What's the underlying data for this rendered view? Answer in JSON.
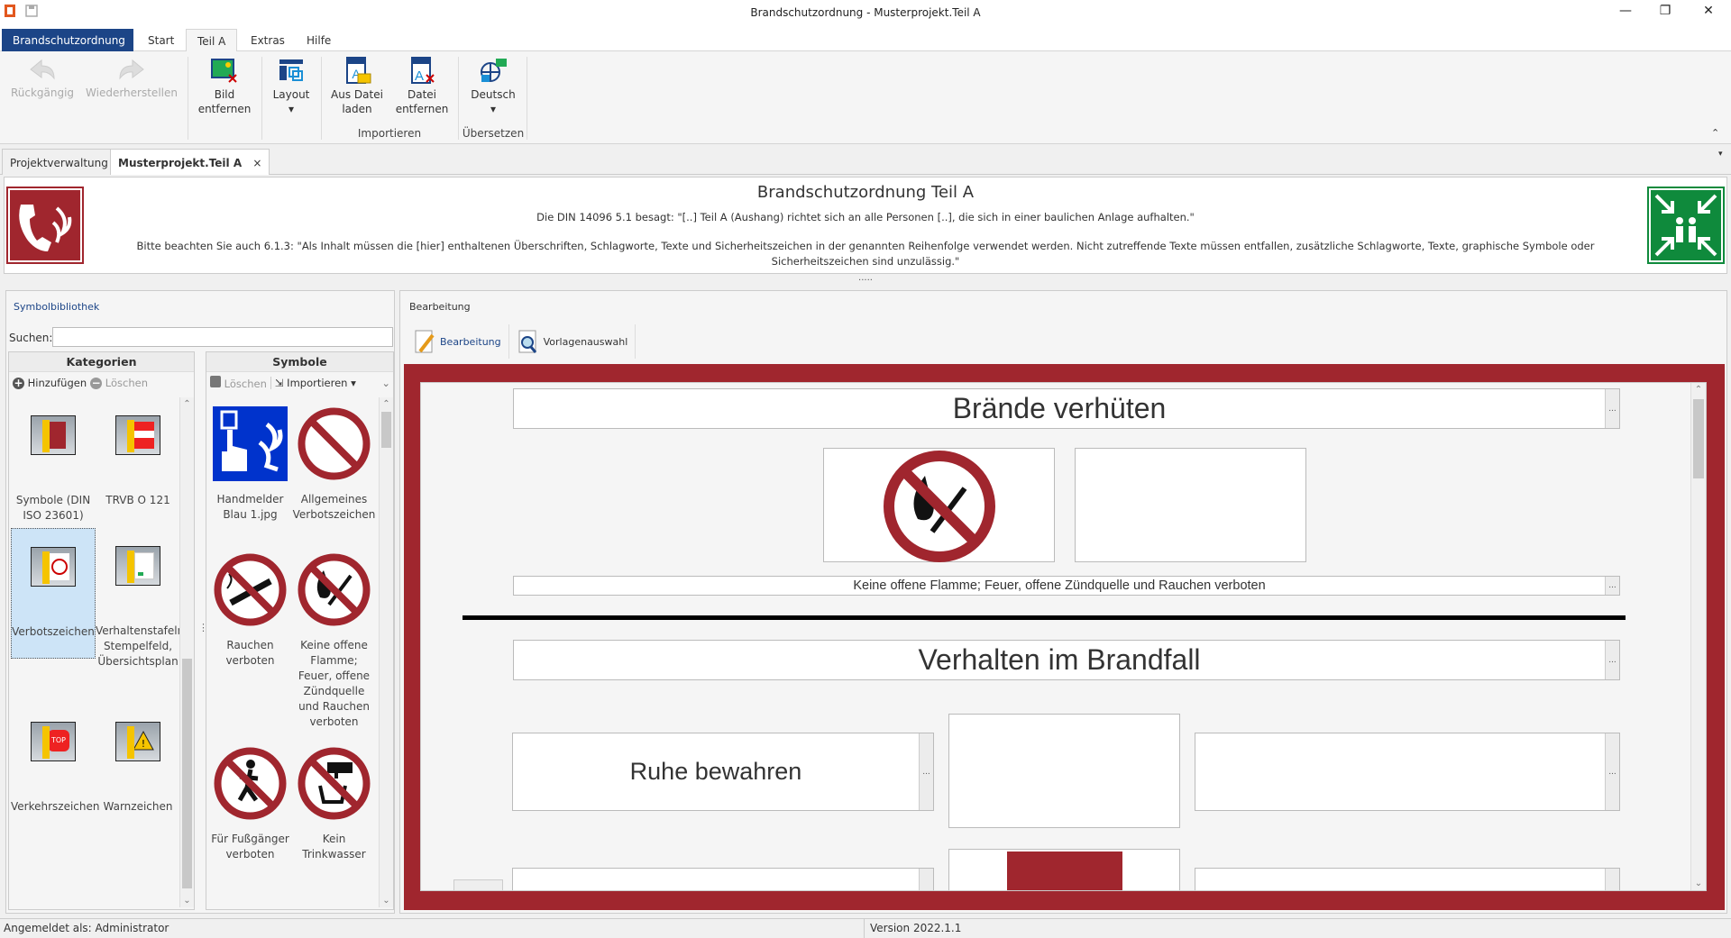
{
  "window": {
    "title": "Brandschutzordnung - Musterprojekt.Teil A",
    "minimize": "—",
    "restore": "❐",
    "close": "✕"
  },
  "ribbon": {
    "tabs": [
      "Brandschutzordnung",
      "Start",
      "Teil A",
      "Extras",
      "Hilfe"
    ],
    "active_tab": "Teil A",
    "buttons": {
      "undo": "Rückgängig",
      "redo": "Wiederherstellen",
      "remove_image": [
        "Bild",
        "entfernen"
      ],
      "layout": "Layout",
      "load_file": [
        "Aus Datei",
        "laden"
      ],
      "remove_file": [
        "Datei",
        "entfernen"
      ],
      "language": "Deutsch"
    },
    "groups": {
      "import": "Importieren",
      "translate": "Übersetzen"
    },
    "dropdown_caret": "▾",
    "collapse": "⌃"
  },
  "doc_tabs": [
    {
      "label": "Projektverwaltung"
    },
    {
      "label": "Musterprojekt.Teil A",
      "close": "×"
    }
  ],
  "header": {
    "title": "Brandschutzordnung Teil A",
    "line1": "Die DIN 14096 5.1 besagt: \"[..] Teil A (Aushang) richtet sich an alle Personen [..], die sich in einer baulichen Anlage aufhalten.\"",
    "line2": "Bitte beachten Sie auch 6.1.3: \"Als Inhalt müssen die [hier] enthaltenen Überschriften, Schlagworte, Texte und Sicherheitszeichen in der genannten Reihenfolge verwendet werden. Nicht zutreffende Texte müssen entfallen, zusätzliche Schlagworte, Texte, graphische Symbole oder Sicherheitszeichen sind unzulässig.\"",
    "splitter": "....."
  },
  "library": {
    "label": "Symbolbibliothek",
    "search_label": "Suchen:",
    "search_value": "",
    "categories": {
      "title": "Kategorien",
      "add": "Hinzufügen",
      "delete": "Löschen",
      "items": [
        "Symbole (DIN ISO 23601)",
        "TRVB O 121",
        "Verbotszeichen",
        "Verhaltenstafeln, Stempelfeld, Übersichtsplan",
        "Verkehrszeichen",
        "Warnzeichen"
      ],
      "selected": "Verbotszeichen"
    },
    "symbols": {
      "title": "Symbole",
      "delete": "Löschen",
      "import": "Importieren",
      "items": [
        "Handmelder Blau 1.jpg",
        "Allgemeines Verbotszeichen",
        "Rauchen verboten",
        "Keine offene Flamme; Feuer, offene Zündquelle und Rauchen verboten",
        "Für Fußgänger verboten",
        "Kein Trinkwasser"
      ]
    }
  },
  "editor": {
    "label": "Bearbeitung",
    "toolbar": [
      "Bearbeitung",
      "Vorlagenauswahl"
    ],
    "sections": [
      {
        "heading": "Brände verhüten",
        "caption": "Keine offene Flamme; Feuer, offene Zündquelle und Rauchen verboten"
      },
      {
        "heading": "Verhalten im Brandfall",
        "text": "Ruhe bewahren"
      }
    ],
    "more": "..."
  },
  "status": {
    "user": "Angemeldet als: Administrator",
    "version": "Version 2022.1.1"
  },
  "colors": {
    "brand": "#1c4587",
    "frame": "#a0262e",
    "exit_green": "#0f8a3c",
    "prohibit_red": "#a0262e",
    "blue_sign": "#0033cc"
  }
}
